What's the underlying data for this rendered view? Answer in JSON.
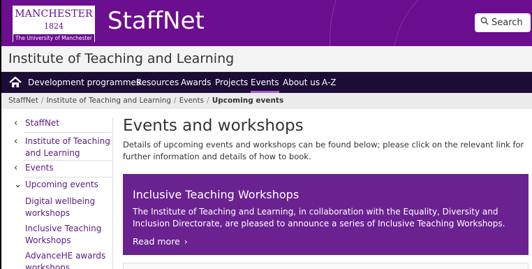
{
  "header": {
    "logo": {
      "name": "MANCHESTER",
      "year": "1824",
      "university": "The University of Manchester"
    },
    "site_title": "StaffNet",
    "search_label": "Search"
  },
  "sub_header": {
    "title": "Institute of Teaching and Learning"
  },
  "nav": {
    "items": [
      {
        "label": "Development programmes"
      },
      {
        "label": "Resources"
      },
      {
        "label": "Awards"
      },
      {
        "label": "Projects"
      },
      {
        "label": "Events"
      },
      {
        "label": "About us"
      },
      {
        "label": "A-Z"
      }
    ],
    "active": "Events"
  },
  "breadcrumb": {
    "items": [
      "StaffNet",
      "Institute of Teaching and Learning",
      "Events"
    ],
    "current": "Upcoming events",
    "separator": "/"
  },
  "sidebar": {
    "items": [
      {
        "chevron": "‹",
        "label": "StaffNet"
      },
      {
        "chevron": "‹",
        "label": "Institute of Teaching and Learning"
      },
      {
        "chevron": "‹",
        "label": "Events"
      },
      {
        "chevron": "⌄",
        "label": "Upcoming events"
      },
      {
        "label": "Digital wellbeing workshops"
      },
      {
        "label": "Inclusive Teaching Workshops"
      },
      {
        "label": "AdvanceHE awards workshops"
      }
    ]
  },
  "main": {
    "title": "Events and workshops",
    "intro": "Details of upcoming events and workshops can be found below; please click on the relevant link for further information and details of how to book.",
    "promo": {
      "title": "Inclusive Teaching Workshops",
      "body": "The Institute of Teaching and Learning, in collaboration with the Equality, Diversity and Inclusion Directorate, are pleased to announce a series of Inclusive Teaching Workshops.",
      "read_more": "Read more",
      "arrow": "›"
    }
  },
  "colors": {
    "brand_purple": "#6b0e8f",
    "nav_dark": "#1c0c36",
    "promo_purple": "#6b2291",
    "link_purple": "#5a1a85"
  }
}
